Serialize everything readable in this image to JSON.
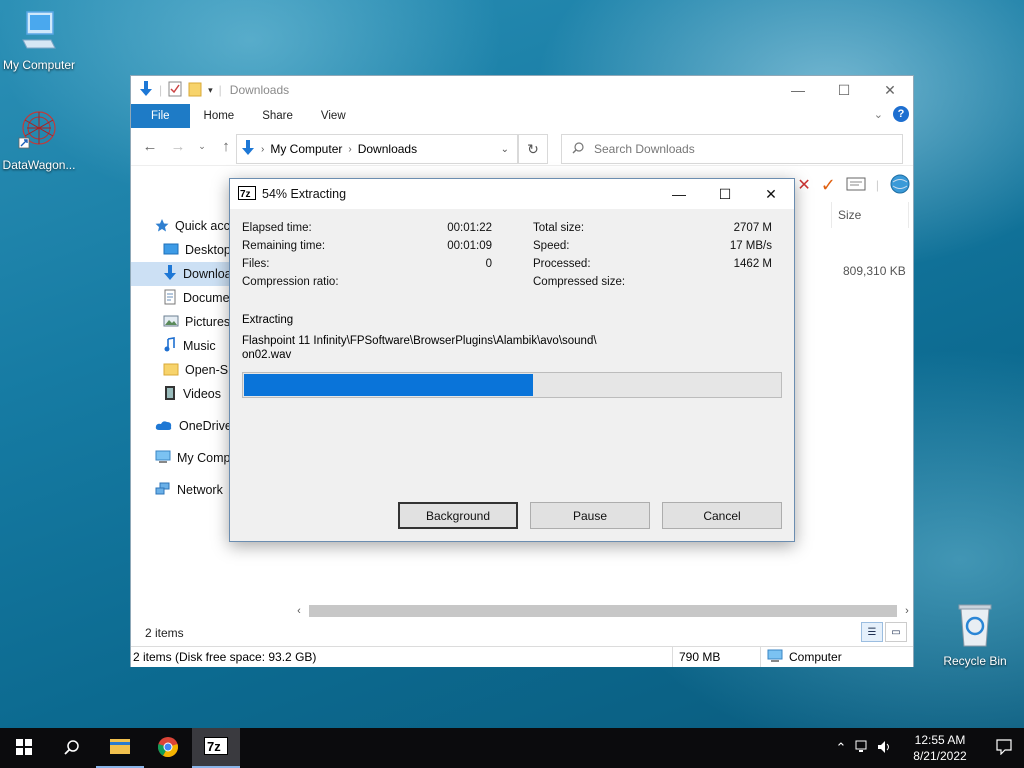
{
  "desktop": {
    "icons": [
      {
        "label": "My Computer",
        "icon": "computer-icon"
      },
      {
        "label": "DataWagon...",
        "icon": "datawagon-shortcut-icon"
      },
      {
        "label": "Recycle Bin",
        "icon": "recycle-bin-icon"
      }
    ]
  },
  "explorer": {
    "title": "Downloads",
    "ribbon_tabs": [
      "File",
      "Home",
      "Share",
      "View"
    ],
    "address": {
      "root": "My Computer",
      "current": "Downloads"
    },
    "search_placeholder": "Search Downloads",
    "column_size": "Size",
    "file_size": "809,310 KB",
    "nav": [
      {
        "label": "Quick access",
        "icon": "star-icon",
        "level": "top"
      },
      {
        "label": "Desktop",
        "icon": "desktop-folder-icon",
        "level": "sub"
      },
      {
        "label": "Downloads",
        "icon": "download-arrow-icon",
        "level": "sub",
        "selected": true
      },
      {
        "label": "Documents",
        "icon": "documents-icon",
        "level": "sub"
      },
      {
        "label": "Pictures",
        "icon": "pictures-icon",
        "level": "sub"
      },
      {
        "label": "Music",
        "icon": "music-note-icon",
        "level": "sub"
      },
      {
        "label": "Open-Sh",
        "icon": "folder-icon",
        "level": "sub"
      },
      {
        "label": "Videos",
        "icon": "videos-icon",
        "level": "sub"
      },
      {
        "label": "OneDrive",
        "icon": "cloud-icon",
        "level": "top"
      },
      {
        "label": "My Computer",
        "icon": "computer-icon",
        "level": "top"
      },
      {
        "label": "Network",
        "icon": "network-icon",
        "level": "top"
      }
    ],
    "items_count": "2 items",
    "status": {
      "summary": "2 items (Disk free space: 93.2 GB)",
      "size": "790 MB",
      "location": "Computer"
    }
  },
  "dialog": {
    "title": "54% Extracting",
    "app_badge": "7z",
    "stats_left": [
      {
        "label": "Elapsed time:",
        "value": "00:01:22"
      },
      {
        "label": "Remaining time:",
        "value": "00:01:09"
      },
      {
        "label": "Files:",
        "value": "0"
      },
      {
        "label": "Compression ratio:",
        "value": ""
      }
    ],
    "stats_right": [
      {
        "label": "Total size:",
        "value": "2707 M"
      },
      {
        "label": "Speed:",
        "value": "17 MB/s"
      },
      {
        "label": "Processed:",
        "value": "1462 M"
      },
      {
        "label": "Compressed size:",
        "value": ""
      }
    ],
    "extracting_label": "Extracting",
    "path_line1": "Flashpoint 11 Infinity\\FPSoftware\\BrowserPlugins\\Alambik\\avo\\sound\\",
    "path_line2": "on02.wav",
    "progress": 0.54,
    "buttons": {
      "background": "Background",
      "pause": "Pause",
      "cancel": "Cancel"
    }
  },
  "taskbar": {
    "time": "12:55 AM",
    "date": "8/21/2022",
    "apps": [
      "start-icon",
      "search-icon",
      "file-explorer-icon",
      "chrome-icon",
      "7zip-icon"
    ],
    "accent": "#0a74d9"
  }
}
